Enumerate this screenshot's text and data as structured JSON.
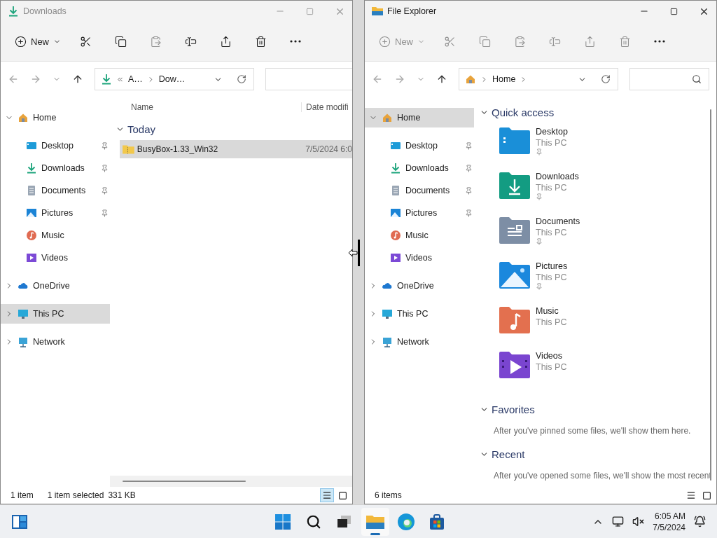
{
  "windows": [
    {
      "kind": "downloads",
      "title": "Downloads",
      "active": false,
      "toolbar": [
        {
          "kind": "new",
          "label": "New",
          "disabled": false
        },
        {
          "kind": "cut",
          "disabled": false
        },
        {
          "kind": "copy",
          "disabled": false
        },
        {
          "kind": "paste",
          "disabled": true
        },
        {
          "kind": "rename",
          "disabled": false
        },
        {
          "kind": "share",
          "disabled": false
        },
        {
          "kind": "delete",
          "disabled": false
        },
        {
          "kind": "more",
          "disabled": false
        }
      ],
      "address": [
        {
          "kind": "overflow"
        },
        {
          "kind": "text",
          "label": "A…"
        },
        {
          "kind": "sep"
        },
        {
          "kind": "text",
          "label": "Dow…"
        }
      ],
      "search": {
        "cut": true
      },
      "sidebar": [
        {
          "kind": "home",
          "label": "Home",
          "expanded": true,
          "selected": false,
          "children": [
            {
              "kind": "desktop",
              "label": "Desktop",
              "pinned": true,
              "selected": false
            },
            {
              "kind": "downloads",
              "label": "Downloads",
              "pinned": true,
              "selected": false
            },
            {
              "kind": "documents",
              "label": "Documents",
              "pinned": true,
              "selected": false
            },
            {
              "kind": "pictures",
              "label": "Pictures",
              "pinned": true,
              "selected": false
            },
            {
              "kind": "music",
              "label": "Music",
              "pinned": false,
              "selected": false
            },
            {
              "kind": "videos",
              "label": "Videos",
              "pinned": false,
              "selected": false
            }
          ]
        },
        {
          "kind": "onedrive",
          "label": "OneDrive",
          "expanded": false,
          "selected": false
        },
        {
          "kind": "thispc",
          "label": "This PC",
          "expanded": false,
          "selected": true
        },
        {
          "kind": "network",
          "label": "Network",
          "expanded": false,
          "selected": false
        }
      ],
      "content": {
        "kind": "details",
        "columns": [
          "Name",
          "Date modifi"
        ],
        "groups": [
          {
            "label": "Today",
            "expanded": true,
            "rows": [
              {
                "name": "BusyBox-1.33_Win32",
                "date": "7/5/2024 6:0",
                "selected": true
              }
            ]
          }
        ]
      },
      "status": {
        "items": [
          "1 item",
          "1 item selected",
          "331 KB"
        ],
        "views": [
          {
            "kind": "details",
            "selected": true
          },
          {
            "kind": "tiles",
            "selected": false
          }
        ]
      }
    },
    {
      "kind": "home",
      "title": "File Explorer",
      "active": true,
      "toolbar": [
        {
          "kind": "new",
          "label": "New",
          "disabled": true
        },
        {
          "kind": "cut",
          "disabled": true
        },
        {
          "kind": "copy",
          "disabled": true
        },
        {
          "kind": "paste",
          "disabled": true
        },
        {
          "kind": "rename",
          "disabled": true
        },
        {
          "kind": "share",
          "disabled": true
        },
        {
          "kind": "delete",
          "disabled": true
        },
        {
          "kind": "more",
          "disabled": false
        }
      ],
      "address": [
        {
          "kind": "sep"
        },
        {
          "kind": "text",
          "label": "Home"
        },
        {
          "kind": "sep"
        }
      ],
      "search": {
        "cut": false
      },
      "sidebar": [
        {
          "kind": "home",
          "label": "Home",
          "expanded": true,
          "selected": true,
          "children": [
            {
              "kind": "desktop",
              "label": "Desktop",
              "pinned": true,
              "selected": false
            },
            {
              "kind": "downloads",
              "label": "Downloads",
              "pinned": true,
              "selected": false
            },
            {
              "kind": "documents",
              "label": "Documents",
              "pinned": true,
              "selected": false
            },
            {
              "kind": "pictures",
              "label": "Pictures",
              "pinned": true,
              "selected": false
            },
            {
              "kind": "music",
              "label": "Music",
              "pinned": false,
              "selected": false
            },
            {
              "kind": "videos",
              "label": "Videos",
              "pinned": false,
              "selected": false
            }
          ]
        },
        {
          "kind": "onedrive",
          "label": "OneDrive",
          "expanded": false,
          "selected": false
        },
        {
          "kind": "thispc",
          "label": "This PC",
          "expanded": false,
          "selected": false
        },
        {
          "kind": "network",
          "label": "Network",
          "expanded": false,
          "selected": false
        }
      ],
      "content": {
        "kind": "home",
        "sections": [
          {
            "title": "Quick access",
            "expanded": true,
            "tiles": [
              {
                "kind": "desktop",
                "name": "Desktop",
                "location": "This PC",
                "pinned": true
              },
              {
                "kind": "downloads",
                "name": "Downloads",
                "location": "This PC",
                "pinned": true
              },
              {
                "kind": "documents",
                "name": "Documents",
                "location": "This PC",
                "pinned": true
              },
              {
                "kind": "pictures",
                "name": "Pictures",
                "location": "This PC",
                "pinned": true
              },
              {
                "kind": "music",
                "name": "Music",
                "location": "This PC",
                "pinned": false
              },
              {
                "kind": "videos",
                "name": "Videos",
                "location": "This PC",
                "pinned": false
              }
            ]
          },
          {
            "title": "Favorites",
            "expanded": true,
            "message": "After you've pinned some files, we'll show them here."
          },
          {
            "title": "Recent",
            "expanded": true,
            "message": "After you've opened some files, we'll show the most recent"
          }
        ]
      },
      "status": {
        "items": [
          "6 items"
        ],
        "views": [
          {
            "kind": "details",
            "selected": false
          },
          {
            "kind": "tiles",
            "selected": false
          }
        ]
      }
    }
  ],
  "taskbar": {
    "apps": [
      {
        "kind": "widgets",
        "active": false
      },
      {
        "kind": "start",
        "active": false
      },
      {
        "kind": "search",
        "active": false
      },
      {
        "kind": "taskview",
        "active": false
      },
      {
        "kind": "explorer",
        "active": true
      },
      {
        "kind": "edge",
        "active": false
      },
      {
        "kind": "store",
        "active": false
      }
    ],
    "time": "6:05 AM",
    "date": "7/5/2024"
  }
}
